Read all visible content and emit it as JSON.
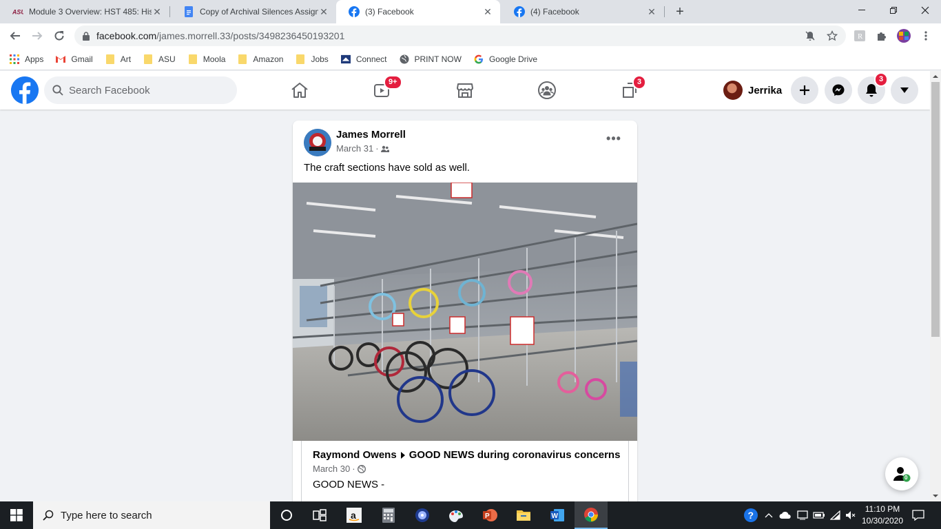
{
  "browser": {
    "tabs": [
      {
        "title": "Module 3 Overview: HST 485: His",
        "favicon": "asu-icon",
        "active": false
      },
      {
        "title": "Copy of Archival Silences Assignn",
        "favicon": "google-docs-icon",
        "active": false
      },
      {
        "title": "(3) Facebook",
        "favicon": "facebook-icon",
        "active": true
      },
      {
        "title": "(4) Facebook",
        "favicon": "facebook-icon",
        "active": false
      }
    ],
    "new_tab": "+",
    "url_host": "facebook.com",
    "url_path": "/james.morrell.33/posts/3498236450193201",
    "bookmarks": [
      {
        "label": "Apps",
        "icon": "apps-grid-icon"
      },
      {
        "label": "Gmail",
        "icon": "gmail-icon"
      },
      {
        "label": "Art",
        "icon": "folder-icon"
      },
      {
        "label": "ASU",
        "icon": "folder-icon"
      },
      {
        "label": "Moola",
        "icon": "folder-icon"
      },
      {
        "label": "Amazon",
        "icon": "folder-icon"
      },
      {
        "label": "Jobs",
        "icon": "folder-icon"
      },
      {
        "label": "Connect",
        "icon": "connect-icon"
      },
      {
        "label": "PRINT NOW",
        "icon": "globe-icon"
      },
      {
        "label": "Google Drive",
        "icon": "google-icon"
      }
    ]
  },
  "facebook": {
    "search_placeholder": "Search Facebook",
    "watch_badge": "9+",
    "gaming_badge": "3",
    "notifications_badge": "3",
    "user_name": "Jerrika",
    "brand_color": "#1877f2"
  },
  "post": {
    "author": "James Morrell",
    "date": "March 31",
    "date_separator": "·",
    "text": "The craft sections have sold as well.",
    "more_label": "•••",
    "shared": {
      "author": "Raymond Owens",
      "group": "GOOD NEWS during coronavirus concerns",
      "date": "March 30",
      "date_separator": "·",
      "text": "GOOD NEWS -"
    }
  },
  "friends_fab_count": "0",
  "taskbar": {
    "search_placeholder": "Type here to search",
    "time": "11:10 PM",
    "date": "10/30/2020"
  }
}
